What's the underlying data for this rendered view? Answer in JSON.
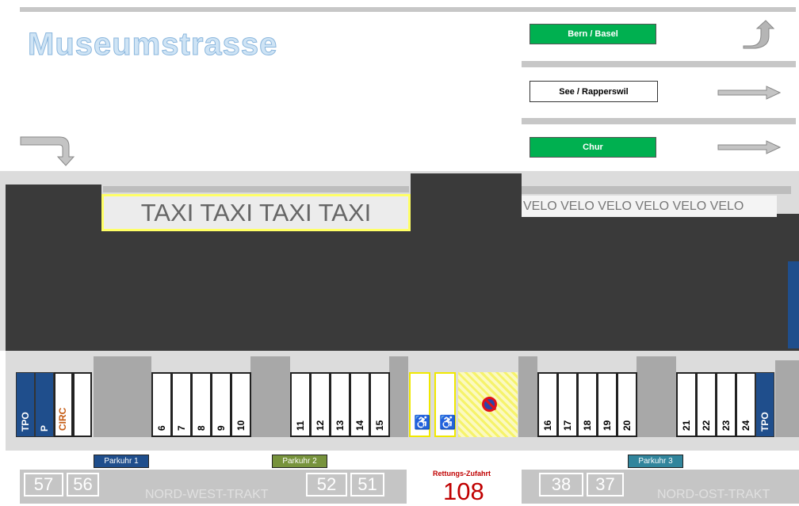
{
  "street": {
    "title": "Museumstrasse"
  },
  "directions": [
    {
      "label": "Bern / Basel",
      "style": "green",
      "arrow": "curved-up-arrow"
    },
    {
      "label": "See / Rapperswil",
      "style": "white",
      "arrow": "right-arrow"
    },
    {
      "label": "Chur",
      "style": "green",
      "arrow": "right-arrow"
    }
  ],
  "turn_arrow_left": "turn-down-arrow",
  "taxi": {
    "label": "TAXI TAXI TAXI TAXI"
  },
  "velo": {
    "label": "VELO VELO VELO VELO VELO VELO"
  },
  "left_special": {
    "tpo": "TPO",
    "p": "P",
    "circ": "CIRC"
  },
  "slots": {
    "group1": [
      "6",
      "7",
      "8",
      "9",
      "10"
    ],
    "group2": [
      "11",
      "12",
      "13",
      "14",
      "15"
    ],
    "group3": [
      "16",
      "17",
      "18",
      "19",
      "20"
    ],
    "group4": [
      "21",
      "22",
      "23",
      "24"
    ]
  },
  "right_special": {
    "tpo": "TPO"
  },
  "handicap_icon": "wheelchair-icon",
  "no_parking_icon": "no-parking-icon",
  "parkuhr": [
    "Parkuhr 1",
    "Parkuhr 2",
    "Parkuhr 3"
  ],
  "colors": {
    "parkuhr1": "#1f4e8c",
    "parkuhr2": "#77933c",
    "parkuhr3": "#31859c",
    "green": "#00b050",
    "taxi_border": "#ffff66",
    "rettung": "#c00000"
  },
  "rettung": {
    "label": "Rettungs-Zufahrt",
    "number": "108"
  },
  "west": {
    "numbers": [
      "57",
      "56",
      "52",
      "51"
    ],
    "label": "NORD-WEST-TRAKT"
  },
  "east": {
    "numbers": [
      "38",
      "37"
    ],
    "label": "NORD-OST-TRAKT"
  }
}
